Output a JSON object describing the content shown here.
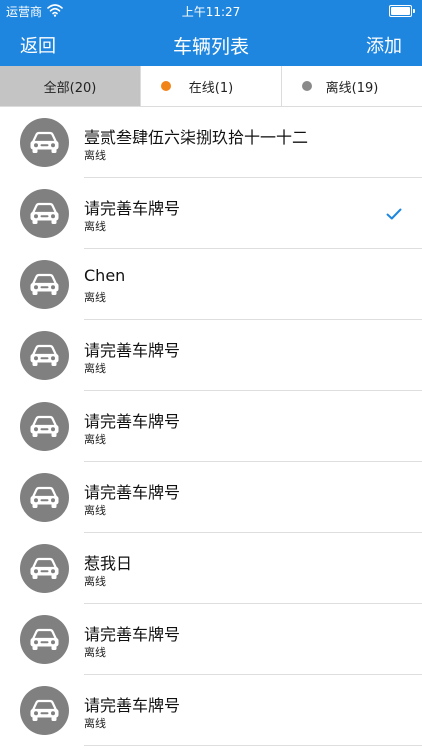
{
  "status_bar": {
    "carrier": "运营商",
    "time": "上午11:27"
  },
  "nav": {
    "back_label": "返回",
    "title": "车辆列表",
    "add_label": "添加"
  },
  "tabs": [
    {
      "label": "全部(20)",
      "active": true
    },
    {
      "label": "在线(1)",
      "dot_color": "#f08418"
    },
    {
      "label": "离线(19)",
      "dot_color": "#8a8a8a"
    }
  ],
  "vehicles": [
    {
      "name": "壹贰叁肆伍六柒捌玖拾十一十二",
      "status": "离线",
      "selected": false
    },
    {
      "name": "请完善车牌号",
      "status": "离线",
      "selected": true
    },
    {
      "name": "Chen",
      "status": "离线",
      "selected": false
    },
    {
      "name": "请完善车牌号",
      "status": "离线",
      "selected": false
    },
    {
      "name": "请完善车牌号",
      "status": "离线",
      "selected": false
    },
    {
      "name": "请完善车牌号",
      "status": "离线",
      "selected": false
    },
    {
      "name": "惹我日",
      "status": "离线",
      "selected": false
    },
    {
      "name": "请完善车牌号",
      "status": "离线",
      "selected": false
    },
    {
      "name": "请完善车牌号",
      "status": "离线",
      "selected": false
    }
  ],
  "colors": {
    "nav_bar": "#1f86e0",
    "active_tab": "#c4c4c4",
    "avatar": "#808080",
    "checkmark": "#1f86e0"
  },
  "icons": {
    "vehicle": "car-icon",
    "selected": "checkmark-icon",
    "signal": "wifi-icon",
    "power": "battery-icon"
  }
}
